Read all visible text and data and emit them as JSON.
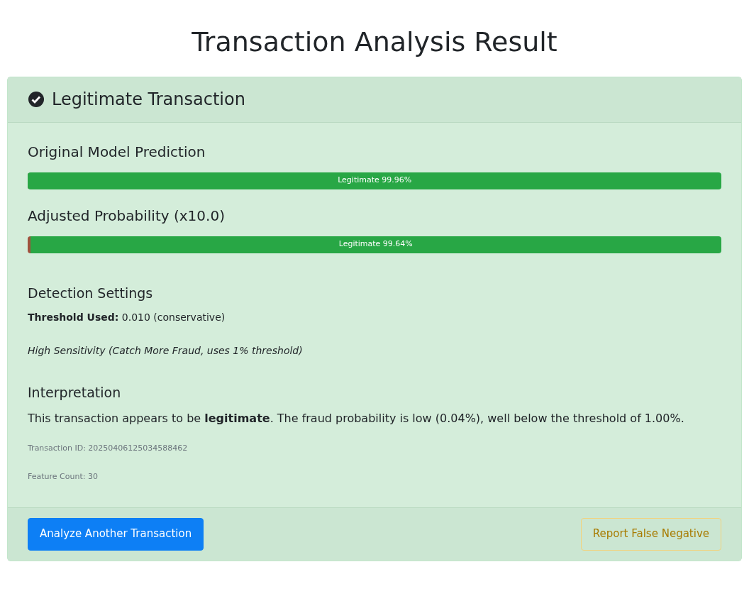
{
  "page_title": "Transaction Analysis Result",
  "card": {
    "header": "Legitimate Transaction",
    "predictions": [
      {
        "title": "Original Model Prediction",
        "level": 0.9996,
        "label": "Legitimate 99.96%"
      },
      {
        "title": "Adjusted Probability (x10.0)",
        "level": 0.9964,
        "label": "Legitimate 99.64%"
      }
    ],
    "settings": {
      "title": "Detection Settings",
      "threshold": "**Threshold Used:** 0.010 (conservative)",
      "mode": "High Sensitivity (Catch More Fraud, uses 1% threshold)"
    },
    "interpretation": {
      "title": "Interpretation",
      "text": "This transaction appears to be **legitimate**. The fraud probability is low (0.04%), well below the threshold of 1.00%."
    },
    "meta": [
      "Transaction ID: 20250406125034588462",
      "Feature Count: 30"
    ],
    "buttons": [
      {
        "label": "Analyze Another Transaction",
        "kind": "primary"
      },
      {
        "label": "Report False Negative",
        "kind": "warning-outline"
      }
    ]
  }
}
